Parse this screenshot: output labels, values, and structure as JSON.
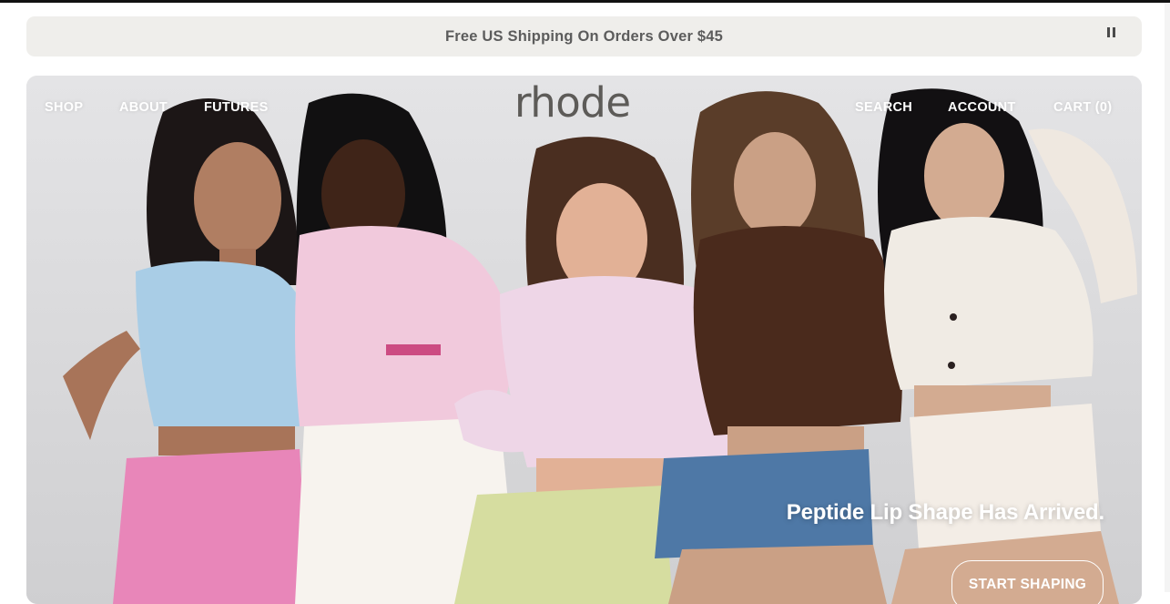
{
  "announcement": {
    "text": "Free US Shipping On Orders Over $45",
    "pause_icon": "pause-icon"
  },
  "nav": {
    "left": [
      "SHOP",
      "ABOUT",
      "FUTURES"
    ],
    "logo": "rhode",
    "right": [
      "SEARCH",
      "ACCOUNT",
      "CART (0)"
    ]
  },
  "hero": {
    "headline": "Peptide Lip Shape Has Arrived.",
    "cta": "START SHAPING",
    "image": "five-models-group-photo",
    "colors": {
      "background": "#dedee0",
      "text": "#ffffff",
      "logo": "#5d5b58"
    }
  }
}
